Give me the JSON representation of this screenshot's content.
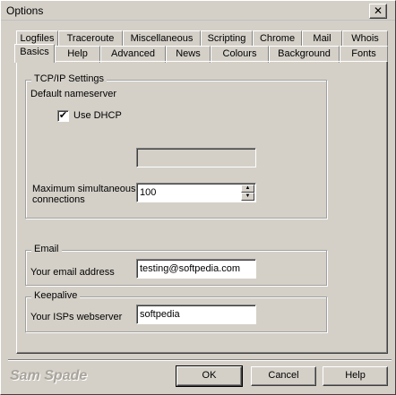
{
  "window": {
    "title": "Options",
    "close_symbol": "✕"
  },
  "tabs_row1": [
    "Logfiles",
    "Traceroute",
    "Miscellaneous",
    "Scripting",
    "Chrome",
    "Mail",
    "Whois"
  ],
  "tabs_row2": [
    "Basics",
    "Help",
    "Advanced",
    "News",
    "Colours",
    "Background",
    "Fonts"
  ],
  "active_tab": "Basics",
  "tcpip": {
    "group_label": "TCP/IP Settings",
    "nameserver_label": "Default nameserver",
    "use_dhcp_label": "Use DHCP",
    "use_dhcp_checked": true,
    "check_mark": "✔",
    "nameserver_value": "",
    "max_conn_label_line1": "Maximum simultaneous",
    "max_conn_label_line2": "connections",
    "max_conn_value": "100"
  },
  "email": {
    "group_label": "Email",
    "address_label": "Your email address",
    "address_value": "testing@softpedia.com"
  },
  "keepalive": {
    "group_label": "Keepalive",
    "webserver_label": "Your ISPs webserver",
    "webserver_value": "softpedia"
  },
  "footer": {
    "brand": "Sam Spade",
    "ok_label": "OK",
    "cancel_label": "Cancel",
    "help_label": "Help"
  }
}
